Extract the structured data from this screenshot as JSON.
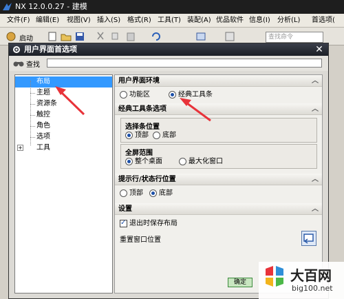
{
  "app": {
    "title": "NX 12.0.0.27 - 建模",
    "menu": [
      "文件(F)",
      "编辑(E)",
      "视图(V)",
      "插入(S)",
      "格式(R)",
      "工具(T)",
      "装配(A)",
      "优品软件",
      "信息(I)",
      "分析(L)",
      "首选项("
    ],
    "toolbar_start_label": "启动",
    "search_placeholder": "查找命令"
  },
  "dialog": {
    "title": "用户界面首选项",
    "find_label": "查找",
    "nav_items": [
      "布局",
      "主题",
      "资源条",
      "触控",
      "角色",
      "选项",
      "工具"
    ],
    "selected_nav": "布局",
    "sections": {
      "ui_env": {
        "title": "用户界面环境",
        "options": [
          "功能区",
          "经典工具条"
        ],
        "selected": "经典工具条"
      },
      "classic_opts": {
        "title": "经典工具条选项",
        "selector_bar": {
          "title": "选择条位置",
          "options": [
            "顶部",
            "底部"
          ],
          "selected": "顶部"
        },
        "fullscreen": {
          "title": "全屏范围",
          "options": [
            "整个桌面",
            "最大化窗口"
          ],
          "selected": "整个桌面"
        }
      },
      "status_pos": {
        "title": "提示行/状态行位置",
        "options": [
          "顶部",
          "底部"
        ],
        "selected": "底部"
      },
      "settings": {
        "title": "设置",
        "save_on_exit_label": "退出时保存布局",
        "save_on_exit_checked": true,
        "reset_label": "重置窗口位置"
      }
    },
    "ok_label": "确定"
  },
  "watermark": {
    "brand": "大百网",
    "url": "big100.net"
  },
  "colors": {
    "selection": "#3399ff",
    "arrow": "#e8333a",
    "title_bar": "#1e1e1e"
  }
}
